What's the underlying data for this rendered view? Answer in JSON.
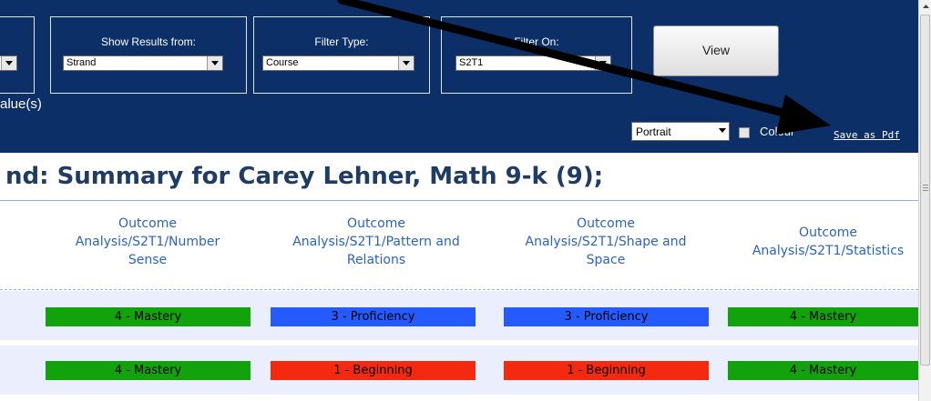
{
  "filters": {
    "show_results": {
      "label": "Show Results from:",
      "value": "Strand"
    },
    "filter_type": {
      "label": "Filter Type:",
      "value": "Course"
    },
    "filter_on": {
      "label": "Filter On:",
      "value": "S2T1"
    },
    "view_label": "View",
    "value_text": "alue(s)",
    "orientation": "Portrait",
    "colour_label": "Colour",
    "save_pdf": "Save as Pdf"
  },
  "report": {
    "title": "nd: Summary for Carey Lehner, Math 9-k (9);",
    "columns": [
      {
        "line1": "Outcome",
        "line2": "Analysis/S2T1/Number",
        "line3": "Sense"
      },
      {
        "line1": "Outcome",
        "line2": "Analysis/S2T1/Pattern and",
        "line3": "Relations"
      },
      {
        "line1": "Outcome",
        "line2": "Analysis/S2T1/Shape and",
        "line3": "Space"
      },
      {
        "line1": "Outcome",
        "line2": "Analysis/S2T1/Statistics",
        "line3": ""
      }
    ],
    "rows": [
      [
        "4 - Mastery",
        "3 - Proficiency",
        "3 - Proficiency",
        "4 - Mastery"
      ],
      [
        "4 - Mastery",
        "1 - Beginning",
        "1 - Beginning",
        "4 - Mastery"
      ]
    ]
  },
  "colors": {
    "header_bg": "#0b2f66",
    "mastery": "#12a20c",
    "proficiency": "#245bfa",
    "beginning": "#f42a10"
  }
}
